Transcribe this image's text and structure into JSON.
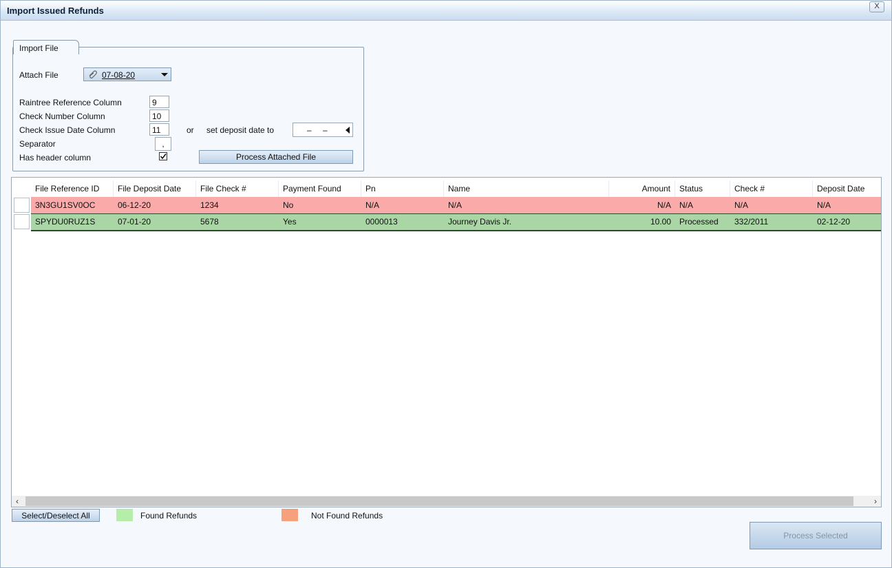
{
  "window": {
    "title": "Import Issued Refunds",
    "close_label": "X"
  },
  "import_group": {
    "title": "Import File",
    "attach_label": "Attach File",
    "attach_value": "07-08-20",
    "raintree_ref_label": "Raintree Reference Column",
    "raintree_ref_value": "9",
    "check_number_label": "Check Number Column",
    "check_number_value": "10",
    "check_issue_label": "Check Issue Date Column",
    "check_issue_value": "11",
    "or_label": "or",
    "set_deposit_label": "set deposit date to",
    "date_dash1": "–",
    "date_dash2": "–",
    "separator_label": "Separator",
    "separator_value": ",",
    "header_label": "Has header column",
    "header_checked": true,
    "process_file_label": "Process Attached File"
  },
  "grid": {
    "columns": [
      "File Reference ID",
      "File Deposit Date",
      "File Check #",
      "Payment Found",
      "Pn",
      "Name",
      "Amount",
      "Status",
      "Check #",
      "Deposit Date"
    ],
    "rows": [
      [
        "3N3GU1SV0OC",
        "06-12-20",
        "1234",
        "No",
        "N/A",
        "N/A",
        "N/A",
        "N/A",
        "N/A",
        "N/A"
      ],
      [
        "SPYDU0RUZ1S",
        "07-01-20",
        "5678",
        "Yes",
        "0000013",
        "Journey Davis Jr.",
        "10.00",
        "Processed",
        "332/2011",
        "02-12-20"
      ]
    ]
  },
  "footer": {
    "select_all_label": "Select/Deselect All",
    "found_label": "Found Refunds",
    "not_found_label": "Not Found Refunds",
    "process_selected_label": "Process Selected"
  },
  "colors": {
    "found": "#b6eea9",
    "not_found": "#f7a07c",
    "row_not_found": "#fbaaaa",
    "row_found": "#a9d6a4"
  }
}
